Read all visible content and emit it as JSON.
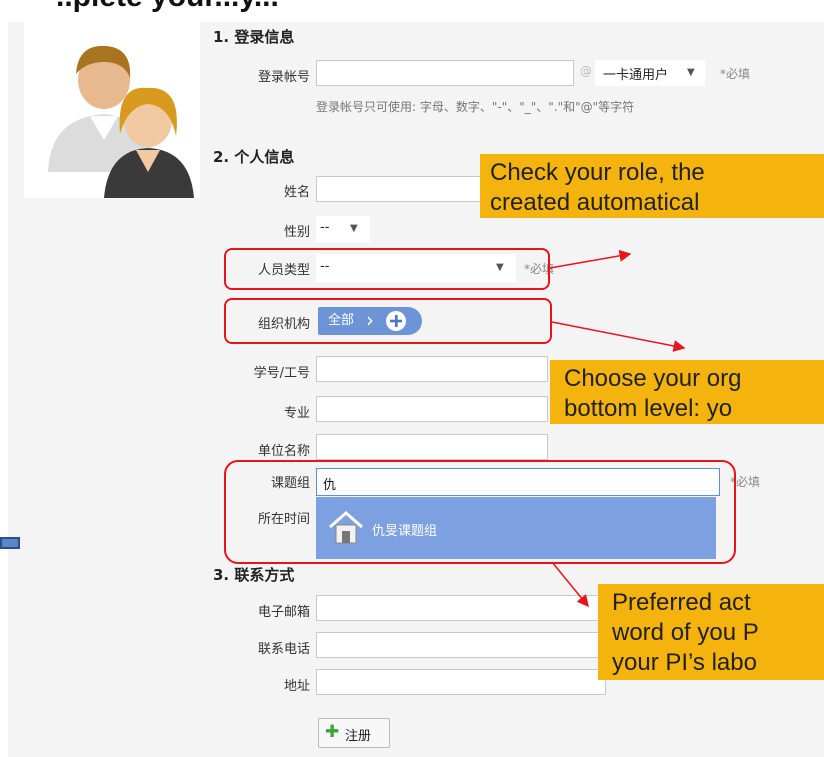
{
  "heading": "..plete your...y...",
  "sections": {
    "login": "1. 登录信息",
    "personal": "2. 个人信息",
    "contact": "3. 联系方式"
  },
  "login": {
    "account_label": "登录帐号",
    "at_sign": "@",
    "domain_select": "一卡通用户",
    "required": "*必填",
    "hint": "登录帐号只可使用: 字母、数字、\"-\"、\"_\"、\".\"和\"@\"等字符"
  },
  "personal": {
    "name_label": "姓名",
    "gender_label": "性别",
    "gender_value": "--",
    "type_label": "人员类型",
    "type_value": "--",
    "type_required": "*必填",
    "org_label": "组织机构",
    "org_chip": "全部",
    "id_label": "学号/工号",
    "major_label": "专业",
    "unit_label": "单位名称",
    "group_label": "课题组",
    "group_value": "仇",
    "group_required": "*必填",
    "time_label": "所在时间",
    "group_suggestion": "仇旻课题组"
  },
  "contact": {
    "email_label": "电子邮箱",
    "phone_label": "联系电话",
    "address_label": "地址"
  },
  "register_button": "注册",
  "callouts": {
    "role": [
      "Check your role, the",
      "created automatical"
    ],
    "org": [
      "Choose your org",
      "bottom level: yo"
    ],
    "group": [
      "Preferred act",
      "word of you P",
      "your PI’s labo"
    ]
  },
  "colors": {
    "highlight": "#e8141b",
    "callout": "#f5b30d",
    "chip": "#6c94d6",
    "dropdown": "#7da0e0"
  }
}
